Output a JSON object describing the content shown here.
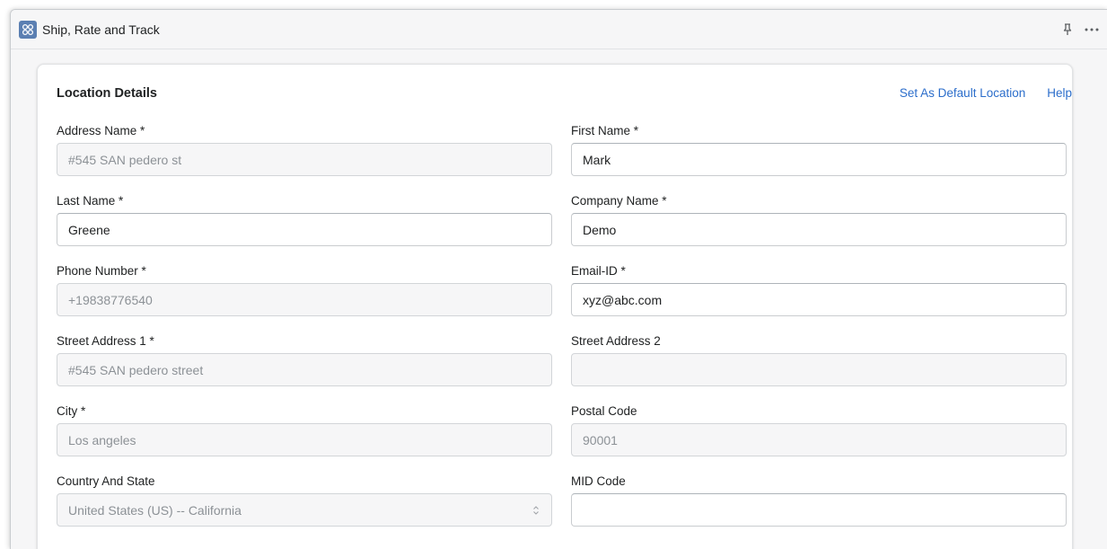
{
  "window": {
    "title": "Ship, Rate and Track"
  },
  "card": {
    "title": "Location Details",
    "links": {
      "set_default": "Set As Default Location",
      "help": "Help"
    }
  },
  "fields": {
    "address_name": {
      "label": "Address Name *",
      "value": "#545 SAN pedero st",
      "disabled": true
    },
    "first_name": {
      "label": "First Name *",
      "value": "Mark",
      "disabled": false
    },
    "last_name": {
      "label": "Last Name *",
      "value": "Greene",
      "disabled": false
    },
    "company_name": {
      "label": "Company Name *",
      "value": "Demo",
      "disabled": false
    },
    "phone_number": {
      "label": "Phone Number *",
      "value": "+19838776540",
      "disabled": true
    },
    "email_id": {
      "label": "Email-ID *",
      "value": "xyz@abc.com",
      "disabled": false
    },
    "street_address_1": {
      "label": "Street Address 1 *",
      "value": "#545 SAN pedero street",
      "disabled": true
    },
    "street_address_2": {
      "label": "Street Address 2",
      "value": "",
      "disabled": true
    },
    "city": {
      "label": "City *",
      "value": "Los angeles",
      "disabled": true
    },
    "postal_code": {
      "label": "Postal Code",
      "value": "90001",
      "disabled": true
    },
    "country_state": {
      "label": "Country And State",
      "selected": "United States (US) -- California",
      "disabled": true
    },
    "mid_code": {
      "label": "MID Code",
      "value": "",
      "disabled": false
    }
  },
  "colors": {
    "link": "#2c6ecb",
    "app_icon": "#5b7fb2",
    "disabled_bg": "#f6f6f7",
    "disabled_text": "#8c9196"
  },
  "icons": {
    "app": "apps-icon",
    "pin": "pin-icon",
    "more": "more-horizontal-icon",
    "select": "select-arrows-icon"
  }
}
